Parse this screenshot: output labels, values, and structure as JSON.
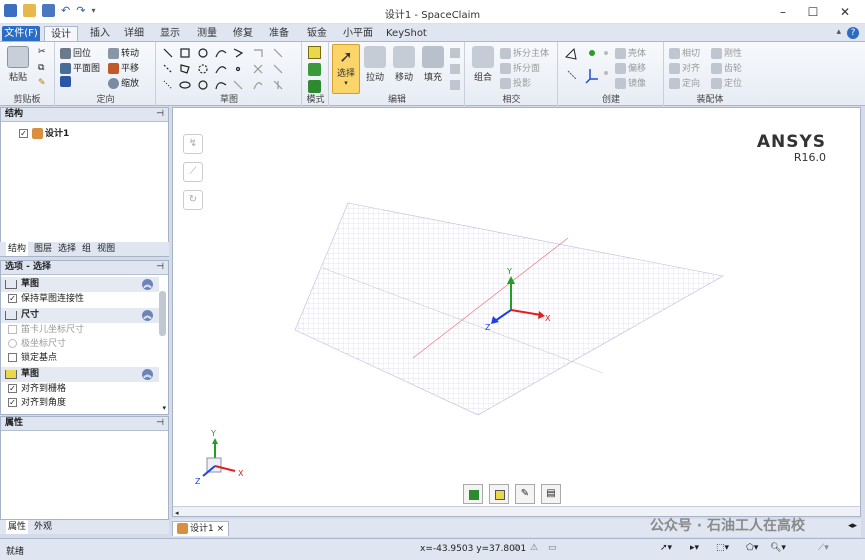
{
  "window": {
    "title": "设计1 - SpaceClaim"
  },
  "tabs": [
    "文件(F)",
    "设计",
    "插入",
    "详细",
    "显示",
    "测量",
    "修复",
    "准备",
    "钣金",
    "小平面",
    "KeyShot"
  ],
  "ribbon": {
    "clipboard": {
      "label": "剪贴板",
      "paste": "粘贴"
    },
    "orient": {
      "label": "定向",
      "items": [
        "回位",
        "转动",
        "平面图",
        "平移",
        "缩放"
      ]
    },
    "sketch": {
      "label": "草图"
    },
    "mode": {
      "label": "模式"
    },
    "edit": {
      "label": "编辑",
      "items": [
        "选择",
        "拉动",
        "移动",
        "填充"
      ]
    },
    "intersect": {
      "label": "相交",
      "combine": "组合",
      "items": [
        "拆分主体",
        "拆分面",
        "投影"
      ]
    },
    "create": {
      "label": "创建",
      "items": [
        "壳体",
        "偏移",
        "镜像"
      ]
    },
    "assembly": {
      "label": "装配体",
      "items": [
        "相切",
        "刚性",
        "对齐",
        "齿轮",
        "定向",
        "定位"
      ]
    }
  },
  "structure": {
    "header": "结构",
    "tree_item": "设计1",
    "tabs": [
      "结构",
      "图层",
      "选择",
      "组",
      "视图"
    ]
  },
  "options": {
    "header": "选项 - 选择",
    "sections": [
      {
        "title": "草图",
        "rows": [
          {
            "label": "保持草图连接性",
            "checked": true,
            "dim": false
          }
        ]
      },
      {
        "title": "尺寸",
        "rows": [
          {
            "label": "笛卡儿坐标尺寸",
            "checked": false,
            "dim": true
          },
          {
            "label": "极坐标尺寸",
            "checked": false,
            "dim": true
          },
          {
            "label": "锁定基点",
            "checked": false,
            "dim": false
          }
        ]
      },
      {
        "title": "草图",
        "rows": [
          {
            "label": "对齐到栅格",
            "checked": true,
            "dim": false
          },
          {
            "label": "对齐到角度",
            "checked": true,
            "dim": false
          }
        ]
      }
    ]
  },
  "properties": {
    "header": "属性",
    "tabs": [
      "属性",
      "外观"
    ]
  },
  "viewport": {
    "brand": "ANSYS",
    "version": "R16.0",
    "axis_y": "Y",
    "axis_x": "X",
    "axis_z": "Z"
  },
  "doc_tab": {
    "label": "设计1"
  },
  "status": {
    "ready": "就绪",
    "coords": "x=-43.9503  y=37.8001"
  },
  "watermark": "公众号 · 石油工人在高校",
  "colors": {
    "accent": "#2b6cc4",
    "grid": "#c9c3e0",
    "axis_red": "#e02020",
    "axis_green": "#20a020",
    "axis_blue": "#2040e0"
  }
}
